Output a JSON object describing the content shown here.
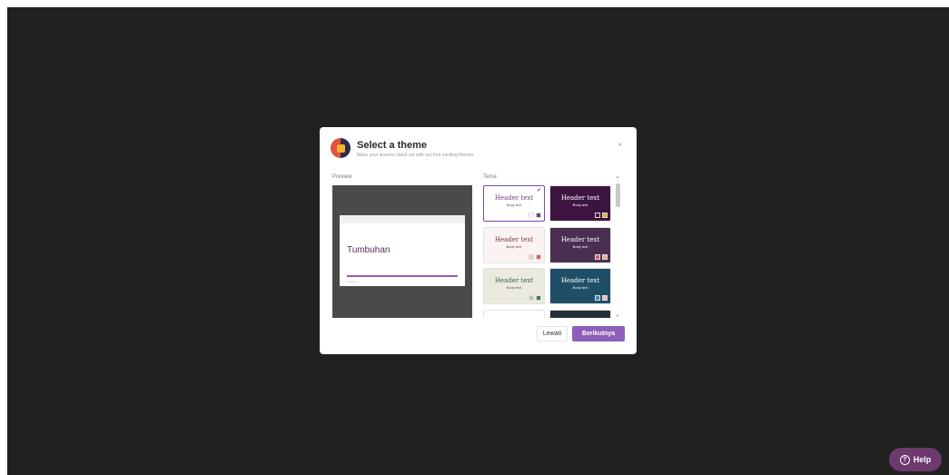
{
  "dialog": {
    "title": "Select a theme",
    "subtitle": "Make your lessons stand out with our free exciting themes",
    "close_label": "×",
    "preview_label": "Preview",
    "themes_label": "Tema",
    "skip_label": "Lewati",
    "next_label": "Berikutnya"
  },
  "preview": {
    "slide_title": "Tumbuhan",
    "slide_footer": "Nearpod"
  },
  "themes": [
    {
      "header": "Header text",
      "body": "Body text",
      "bg": "#ffffff",
      "header_color": "#7a3a7a",
      "body_color": "#7a3a7a",
      "swatches": [
        "#ffffff",
        "#7a3a7a"
      ],
      "selected": true
    },
    {
      "header": "Header text",
      "body": "Body text",
      "bg": "#3d1440",
      "header_color": "#ffffff",
      "body_color": "#ffffff",
      "swatches": [
        "#3d1440",
        "#f2a33a"
      ],
      "selected": false
    },
    {
      "header": "Header text",
      "body": "Body text",
      "bg": "#fbf3f2",
      "header_color": "#7a3a3a",
      "body_color": "#7a3a3a",
      "swatches": [
        "#e8c9c4",
        "#d85c5c"
      ],
      "selected": false
    },
    {
      "header": "Header text",
      "body": "Body text",
      "bg": "#4b2f52",
      "header_color": "#ffffff",
      "body_color": "#ffffff",
      "swatches": [
        "#d85c5c",
        "#f4a29a"
      ],
      "selected": false
    },
    {
      "header": "Header text",
      "body": "Body text",
      "bg": "#eceadf",
      "header_color": "#3f5c55",
      "body_color": "#3f5c55",
      "swatches": [
        "#c9c3a0",
        "#3a7a5a"
      ],
      "selected": false
    },
    {
      "header": "Header text",
      "body": "Body text",
      "bg": "#1f4f66",
      "header_color": "#ffffff",
      "body_color": "#ffffff",
      "swatches": [
        "#3a8ac4",
        "#f4b4b4"
      ],
      "selected": false
    },
    {
      "header": "",
      "body": "",
      "bg": "#ffffff",
      "header_color": "#333333",
      "body_color": "#333333",
      "swatches": [],
      "selected": false
    },
    {
      "header": "",
      "body": "",
      "bg": "#24303a",
      "header_color": "#ffffff",
      "body_color": "#ffffff",
      "swatches": [],
      "selected": false
    }
  ],
  "help": {
    "label": "Help",
    "icon": "?"
  },
  "colors": {
    "backdrop": "#212121",
    "accent": "#8d5fb8",
    "help_bg": "#6d3a6d"
  }
}
